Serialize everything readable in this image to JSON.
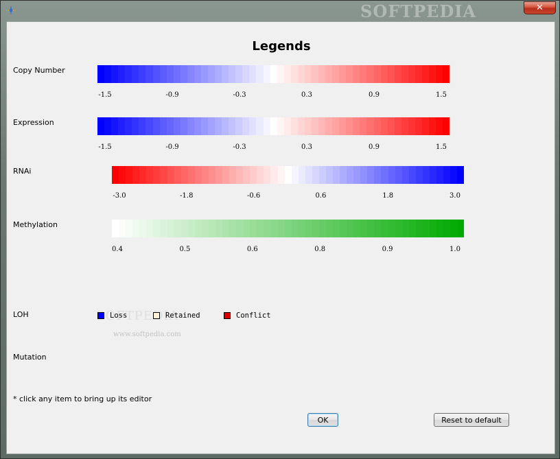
{
  "window": {
    "title": "",
    "close_label": "✕",
    "watermark": "SOFTPEDIA"
  },
  "dialog_title": "Legends",
  "rows": {
    "copy_number": {
      "label": "Copy Number",
      "ticks": [
        "-1.5",
        "-0.9",
        "-0.3",
        "0.3",
        "0.9",
        "1.5"
      ],
      "colors": [
        "#0000ff",
        "#ffffff",
        "#ff0000"
      ]
    },
    "expression": {
      "label": "Expression",
      "ticks": [
        "-1.5",
        "-0.9",
        "-0.3",
        "0.3",
        "0.9",
        "1.5"
      ],
      "colors": [
        "#0000ff",
        "#ffffff",
        "#ff0000"
      ]
    },
    "rnai": {
      "label": "RNAi",
      "ticks": [
        "-3.0",
        "-1.8",
        "-0.6",
        "0.6",
        "1.8",
        "3.0"
      ],
      "colors": [
        "#ff0000",
        "#ffffff",
        "#0000ff"
      ]
    },
    "methylation": {
      "label": "Methylation",
      "ticks": [
        "0.4",
        "0.5",
        "0.6",
        "0.8",
        "0.9",
        "1.0"
      ],
      "colors": [
        "#ffffff",
        "#00aa00"
      ]
    },
    "loh": {
      "label": "LOH",
      "items": [
        {
          "label": "Loss",
          "color": "#0000ff"
        },
        {
          "label": "Retained",
          "color": "#fff0d8"
        },
        {
          "label": "Conflict",
          "color": "#dd0000"
        }
      ]
    },
    "mutation": {
      "label": "Mutation"
    }
  },
  "note": "* click any item to bring up its editor",
  "buttons": {
    "ok": "OK",
    "reset": "Reset to default"
  },
  "softpedia_watermark": "SOFTPEDIA",
  "softpedia_url": "www.softpedia.com"
}
